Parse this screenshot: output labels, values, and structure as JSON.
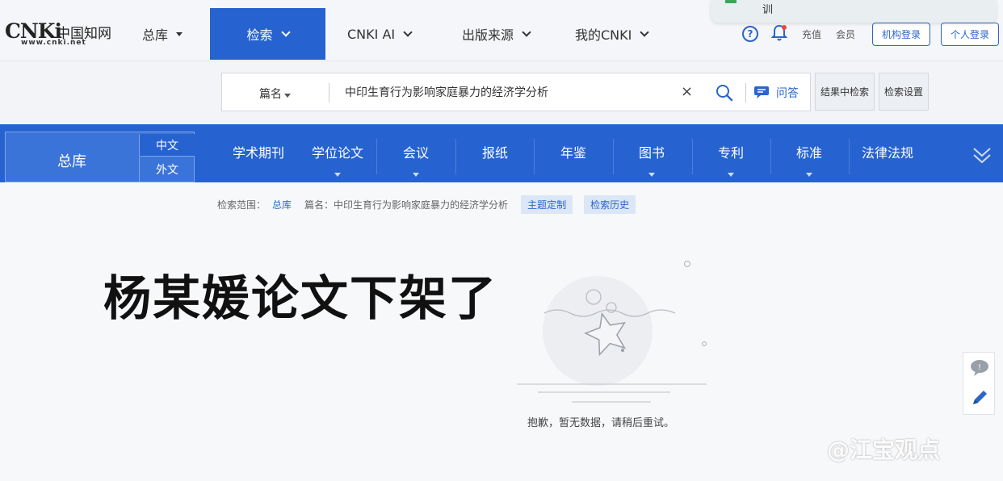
{
  "header": {
    "logo": {
      "mark": "CNKi",
      "cn_name": "中国知网",
      "url": "www.cnki.net"
    },
    "nav": [
      {
        "label": "总库",
        "type": "caret"
      },
      {
        "label": "检索",
        "type": "chevron",
        "active": true
      },
      {
        "label": "CNKI AI",
        "type": "chevron"
      },
      {
        "label": "出版来源",
        "type": "chevron"
      },
      {
        "label": "我的CNKI",
        "type": "chevron"
      }
    ],
    "help_icon": "?",
    "links": {
      "recharge": "充值",
      "member": "会员"
    },
    "buttons": {
      "institution_login": "机构登录",
      "personal_login": "个人登录"
    },
    "popup_text": "训"
  },
  "search": {
    "field": "篇名",
    "query": "中印生育行为影响家庭暴力的经济学分析",
    "clear_icon": "×",
    "qa_label": "问答",
    "search_in_results": "结果中检索",
    "search_settings": "检索设置"
  },
  "categories": {
    "main": "总库",
    "lang_cn": "中文",
    "lang_en": "外文",
    "items": [
      {
        "label": "学术期刊",
        "has_dropdown": false
      },
      {
        "label": "学位论文",
        "has_dropdown": true
      },
      {
        "label": "会议",
        "has_dropdown": true
      },
      {
        "label": "报纸",
        "has_dropdown": false
      },
      {
        "label": "年鉴",
        "has_dropdown": false
      },
      {
        "label": "图书",
        "has_dropdown": true
      },
      {
        "label": "专利",
        "has_dropdown": true
      },
      {
        "label": "标准",
        "has_dropdown": true
      },
      {
        "label": "法律法规",
        "has_dropdown": false
      }
    ]
  },
  "results": {
    "scope_label": "检索范围：",
    "scope_value": "总库",
    "query_label": "篇名：",
    "query_value": "中印生育行为影响家庭暴力的经济学分析",
    "topic_custom": "主题定制",
    "search_history": "检索历史",
    "empty_message": "抱歉，暂无数据，请稍后重试。"
  },
  "overlay_caption": "杨某媛论文下架了",
  "watermark": "@江宝观点",
  "colors": {
    "primary": "#2663d0",
    "link": "#2b66c8"
  }
}
